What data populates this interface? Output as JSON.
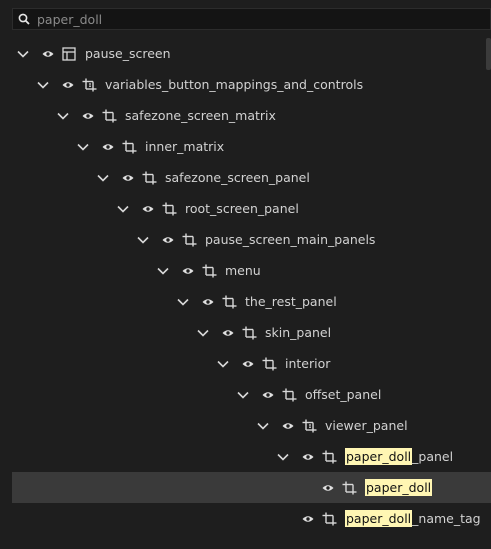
{
  "search": {
    "value": "paper_doll",
    "icon": "search-icon"
  },
  "tree": {
    "highlight_term": "paper_doll",
    "nodes": [
      {
        "label": "pause_screen",
        "depth": 0,
        "expandable": true,
        "icon": "grid-panel-icon",
        "selected": false
      },
      {
        "label": "variables_button_mappings_and_controls",
        "depth": 1,
        "expandable": true,
        "icon": "stack-panel-icon",
        "selected": false
      },
      {
        "label": "safezone_screen_matrix",
        "depth": 2,
        "expandable": true,
        "icon": "panel-icon",
        "selected": false
      },
      {
        "label": "inner_matrix",
        "depth": 3,
        "expandable": true,
        "icon": "panel-icon",
        "selected": false
      },
      {
        "label": "safezone_screen_panel",
        "depth": 4,
        "expandable": true,
        "icon": "panel-icon",
        "selected": false
      },
      {
        "label": "root_screen_panel",
        "depth": 5,
        "expandable": true,
        "icon": "panel-icon",
        "selected": false
      },
      {
        "label": "pause_screen_main_panels",
        "depth": 6,
        "expandable": true,
        "icon": "panel-icon",
        "selected": false
      },
      {
        "label": "menu",
        "depth": 7,
        "expandable": true,
        "icon": "panel-icon",
        "selected": false
      },
      {
        "label": "the_rest_panel",
        "depth": 8,
        "expandable": true,
        "icon": "panel-icon",
        "selected": false
      },
      {
        "label": "skin_panel",
        "depth": 9,
        "expandable": true,
        "icon": "panel-icon",
        "selected": false
      },
      {
        "label": "interior",
        "depth": 10,
        "expandable": true,
        "icon": "panel-icon",
        "selected": false
      },
      {
        "label": "offset_panel",
        "depth": 11,
        "expandable": true,
        "icon": "panel-icon",
        "selected": false
      },
      {
        "label": "viewer_panel",
        "depth": 12,
        "expandable": true,
        "icon": "stack-panel-icon",
        "selected": false
      },
      {
        "label": "paper_doll_panel",
        "depth": 13,
        "expandable": true,
        "icon": "panel-icon",
        "selected": false
      },
      {
        "label": "paper_doll",
        "depth": 14,
        "expandable": false,
        "icon": "panel-icon",
        "selected": true
      },
      {
        "label": "paper_doll_name_tag",
        "depth": 13,
        "expandable": false,
        "icon": "panel-icon",
        "selected": false
      }
    ]
  },
  "colors": {
    "background": "#1e1e1e",
    "selected_row": "#3a3a3a",
    "highlight": "#fff6b3",
    "text": "#d2d2d2"
  }
}
